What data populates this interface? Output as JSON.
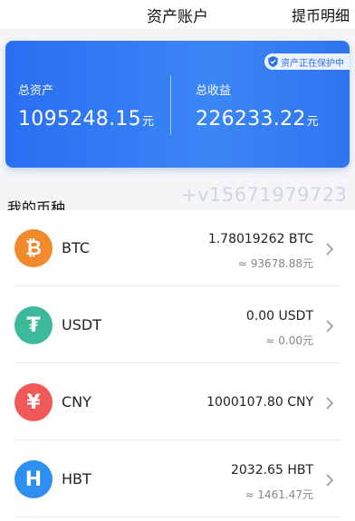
{
  "header": {
    "title": "资产账户",
    "right_link": "提币明细"
  },
  "card": {
    "badge": "资产正在保护中",
    "total_assets_label": "总资产",
    "total_assets_value": "1095248.15",
    "total_assets_unit": "元",
    "total_income_label": "总收益",
    "total_income_value": "226233.22",
    "total_income_unit": "元",
    "colors": {
      "gradient_start": "#2a6ef2",
      "gradient_end": "#3b86f5"
    }
  },
  "watermark": "+v15671979723",
  "section_title": "我的币种",
  "coins": [
    {
      "symbol": "BTC",
      "amount": "1.78019262 BTC",
      "value": "≈ 93678.88元",
      "icon": "bitcoin-icon",
      "glyph": "₿",
      "color": "#f08a2c"
    },
    {
      "symbol": "USDT",
      "amount": "0.00 USDT",
      "value": "≈ 0.00元",
      "icon": "tether-icon",
      "glyph": "₮",
      "color": "#3bb99a"
    },
    {
      "symbol": "CNY",
      "amount": "1000107.80 CNY",
      "value": "",
      "icon": "yuan-icon",
      "glyph": "¥",
      "color": "#f0595a"
    },
    {
      "symbol": "HBT",
      "amount": "2032.65 HBT",
      "value": "≈ 1461.47元",
      "icon": "hbt-icon",
      "glyph": "H",
      "color": "#2f8ff0"
    }
  ]
}
